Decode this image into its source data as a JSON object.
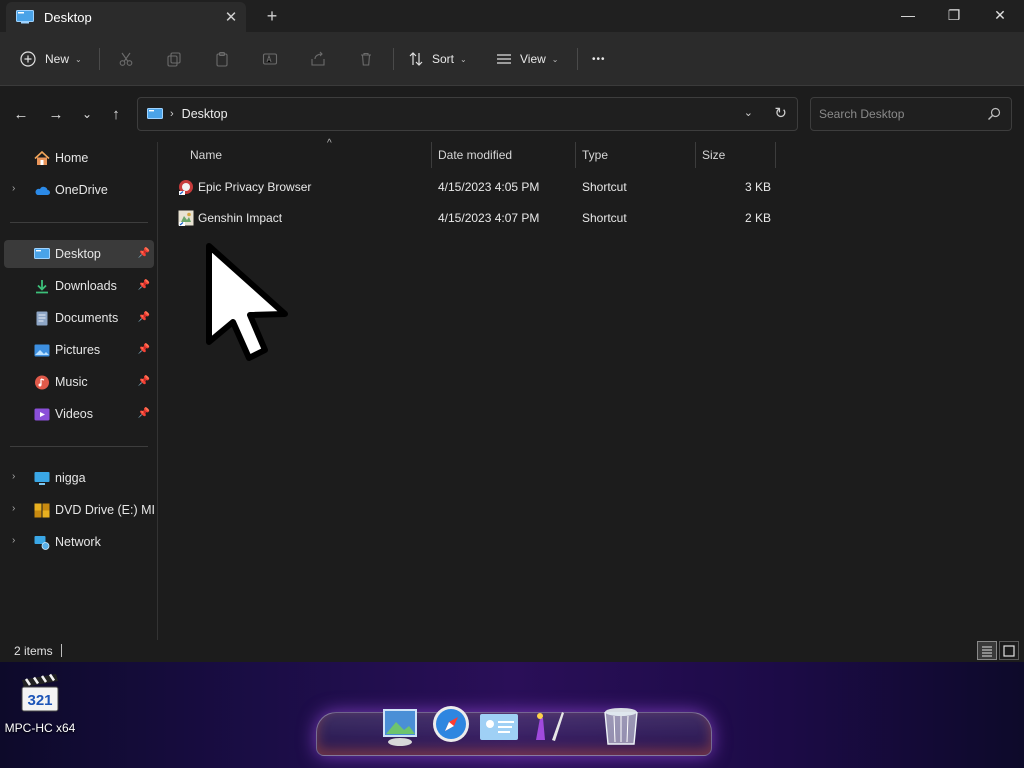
{
  "window": {
    "tab_title": "Desktop",
    "tab_close": "✕",
    "new_tab": "+",
    "minimize": "—",
    "restore": "❐",
    "close": "✕"
  },
  "toolbar": {
    "new_label": "New",
    "sort_label": "Sort",
    "view_label": "View",
    "more_label": "•••",
    "caret": "⌄"
  },
  "nav": {
    "back": "←",
    "forward": "→",
    "recent": "⌄",
    "up": "↑",
    "breadcrumb": "Desktop",
    "chevron": "›",
    "address_dropdown": "⌄",
    "refresh": "↻"
  },
  "search": {
    "placeholder": "Search Desktop"
  },
  "sidebar": {
    "quick": [
      {
        "label": "Home",
        "icon": "home-icon",
        "expander": ""
      },
      {
        "label": "OneDrive",
        "icon": "onedrive-icon",
        "expander": "›"
      }
    ],
    "pinned": [
      {
        "label": "Desktop",
        "icon": "desktop-icon",
        "pin": "📌",
        "selected": true
      },
      {
        "label": "Downloads",
        "icon": "downloads-icon",
        "pin": "📌"
      },
      {
        "label": "Documents",
        "icon": "documents-icon",
        "pin": "📌"
      },
      {
        "label": "Pictures",
        "icon": "pictures-icon",
        "pin": "📌"
      },
      {
        "label": "Music",
        "icon": "music-icon",
        "pin": "📌"
      },
      {
        "label": "Videos",
        "icon": "videos-icon",
        "pin": "📌"
      }
    ],
    "devices": [
      {
        "label": "nigga",
        "icon": "computer-icon",
        "expander": "›"
      },
      {
        "label": "DVD Drive (E:) MICR",
        "icon": "dvd-drive-icon",
        "expander": "›"
      },
      {
        "label": "Network",
        "icon": "network-icon",
        "expander": "›"
      }
    ]
  },
  "columns": {
    "name": "Name",
    "date": "Date modified",
    "type": "Type",
    "size": "Size",
    "sort_indicator": "^"
  },
  "files": [
    {
      "name": "Epic Privacy Browser",
      "date": "4/15/2023 4:05 PM",
      "type": "Shortcut",
      "size": "3 KB",
      "icon": "epic-browser-icon"
    },
    {
      "name": "Genshin Impact",
      "date": "4/15/2023 4:07 PM",
      "type": "Shortcut",
      "size": "2 KB",
      "icon": "genshin-impact-icon"
    }
  ],
  "status": {
    "items": "2 items"
  },
  "desktop": {
    "icon_label": "MPC-HC x64",
    "icon_badge": "321"
  },
  "colors": {
    "bg": "#1c1c1c",
    "toolbar": "#2b2b2b",
    "selected": "#3a3a3a",
    "accent_blue": "#4aa3e8"
  }
}
